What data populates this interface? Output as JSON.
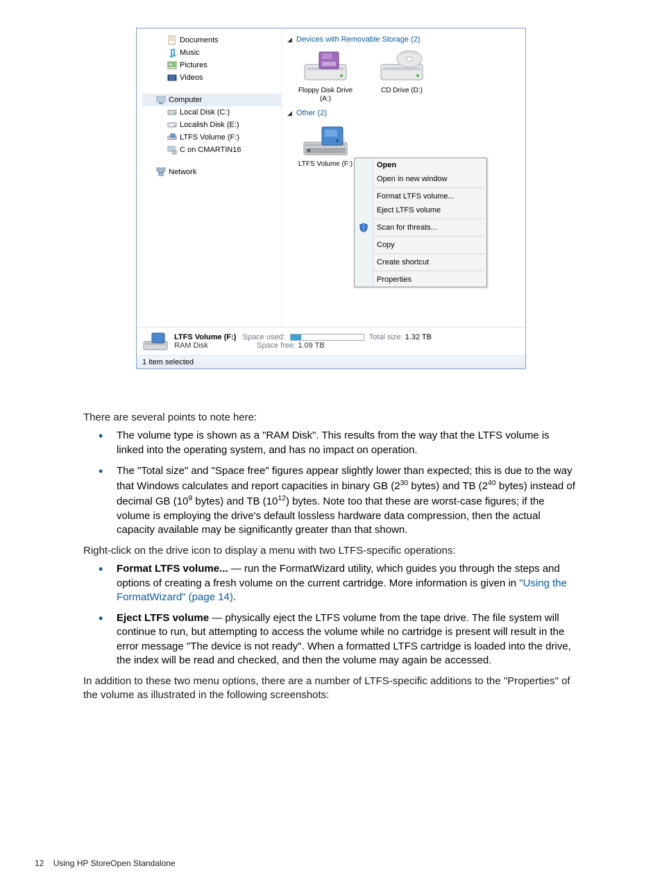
{
  "nav": {
    "items": [
      {
        "label": "Documents",
        "indent": 1
      },
      {
        "label": "Music",
        "indent": 1
      },
      {
        "label": "Pictures",
        "indent": 1
      },
      {
        "label": "Videos",
        "indent": 1
      }
    ],
    "computer": "Computer",
    "drives": [
      "Local Disk (C:)",
      "Localish Disk (E:)",
      "LTFS Volume (F:)",
      "C on CMARTIN16"
    ],
    "network": "Network"
  },
  "groups": {
    "removable": {
      "header": "Devices with Removable Storage (2)",
      "items": [
        {
          "label": "Floppy Disk Drive (A:)"
        },
        {
          "label": "CD Drive (D:)"
        }
      ]
    },
    "other": {
      "header": "Other (2)",
      "items": [
        {
          "label": "LTFS Volume (F:)"
        }
      ]
    }
  },
  "context_menu": {
    "items": [
      "Open",
      "Open in new window",
      "-",
      "Format LTFS volume...",
      "Eject LTFS volume",
      "-",
      "Scan for threats...",
      "-",
      "Copy",
      "-",
      "Create shortcut",
      "-",
      "Properties"
    ],
    "shield_index": 6
  },
  "details": {
    "name": "LTFS Volume (F:)",
    "type": "RAM Disk",
    "space_used_label": "Space used:",
    "space_free_label": "Space free:",
    "space_free": "1.09 TB",
    "total_size_label": "Total size:",
    "total_size": "1.32 TB"
  },
  "status_bar": "1 item selected",
  "body": {
    "intro": "There are several points to note here:",
    "bullets1": [
      "The volume type is shown as a \"RAM Disk\". This results from the way that the LTFS volume is linked into the operating system, and has no impact on operation.",
      "The \"Total size\" and \"Space free\" figures appear slightly lower than expected; this is due to the way that Windows calculates and report capacities in binary GB (2^30 bytes) and TB (2^40 bytes) instead of decimal GB (10^9 bytes) and TB (10^12) bytes. Note too that these are worst-case figures; if the volume is employing the drive's default lossless hardware data compression, then the actual capacity available may be significantly greater than that shown."
    ],
    "mid": "Right-click on the drive icon to display a menu with two LTFS-specific operations:",
    "bullets2": [
      {
        "bold": "Format LTFS volume...",
        "text": " — run the FormatWizard utility, which guides you through the steps and options of creating a fresh volume on the current cartridge. More information is given in ",
        "link": "\"Using the FormatWizard\" (page 14)",
        "tail": "."
      },
      {
        "bold": "Eject LTFS volume",
        "text": " — physically eject the LTFS volume from the tape drive. The file system will continue to run, but attempting to access the volume while no cartridge is present will result in the error message \"The device is not ready\". When a formatted LTFS cartridge is loaded into the drive, the index will be read and checked, and then the volume may again be accessed."
      }
    ],
    "outro": "In addition to these two menu options, there are a number of LTFS-specific additions to the \"Properties\" of the volume as illustrated in the following screenshots:"
  },
  "footer": {
    "page": "12",
    "title": "Using HP StoreOpen Standalone"
  }
}
